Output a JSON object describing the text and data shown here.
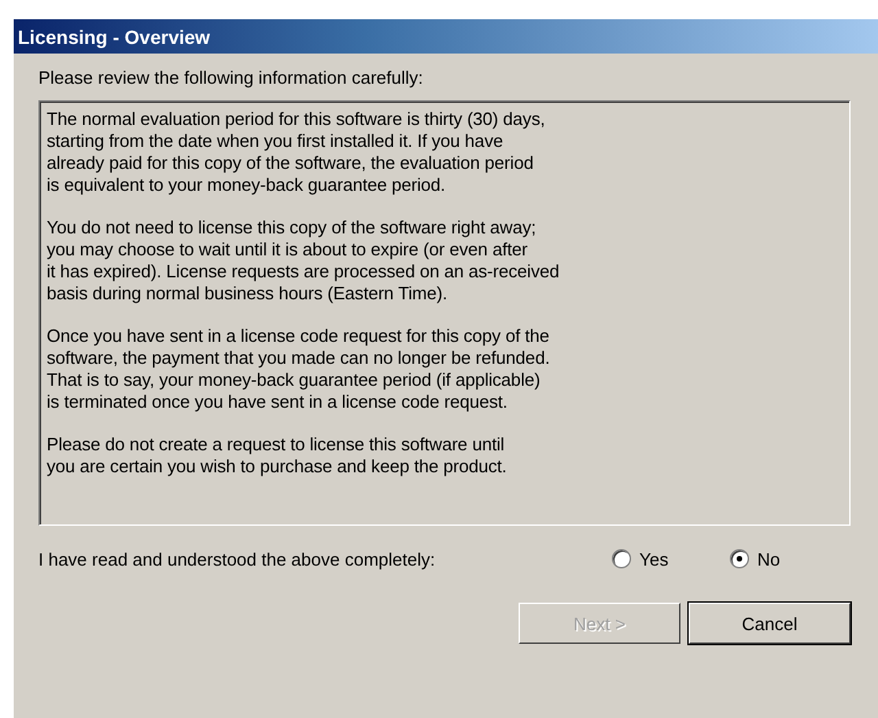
{
  "window": {
    "title": "Licensing - Overview"
  },
  "intro": "Please review the following information carefully:",
  "paragraphs": [
    "The normal evaluation period for this software is thirty (30) days,\nstarting from the date when you first installed it.  If you have\nalready paid for this copy of the software, the evaluation period\nis equivalent to your money-back guarantee period.",
    "You do not need to license this copy of the software right away;\nyou may choose to wait until it is about to expire (or even after\nit has expired).  License requests are processed on an as-received\nbasis during normal business hours (Eastern Time).",
    "Once you have sent in a license code request for this copy of the\nsoftware, the payment that you made can no longer be refunded.\nThat is to say, your money-back guarantee period (if applicable)\nis terminated once you have sent in a license code request.",
    "Please do not create a request to license this software until\nyou are certain you wish to purchase and keep the product."
  ],
  "question": "I have read and understood the above completely:",
  "options": [
    {
      "label": "Yes",
      "selected": false
    },
    {
      "label": "No",
      "selected": true
    }
  ],
  "buttons": [
    {
      "label": "Next >",
      "disabled": true
    },
    {
      "label": "Cancel",
      "disabled": false
    }
  ]
}
